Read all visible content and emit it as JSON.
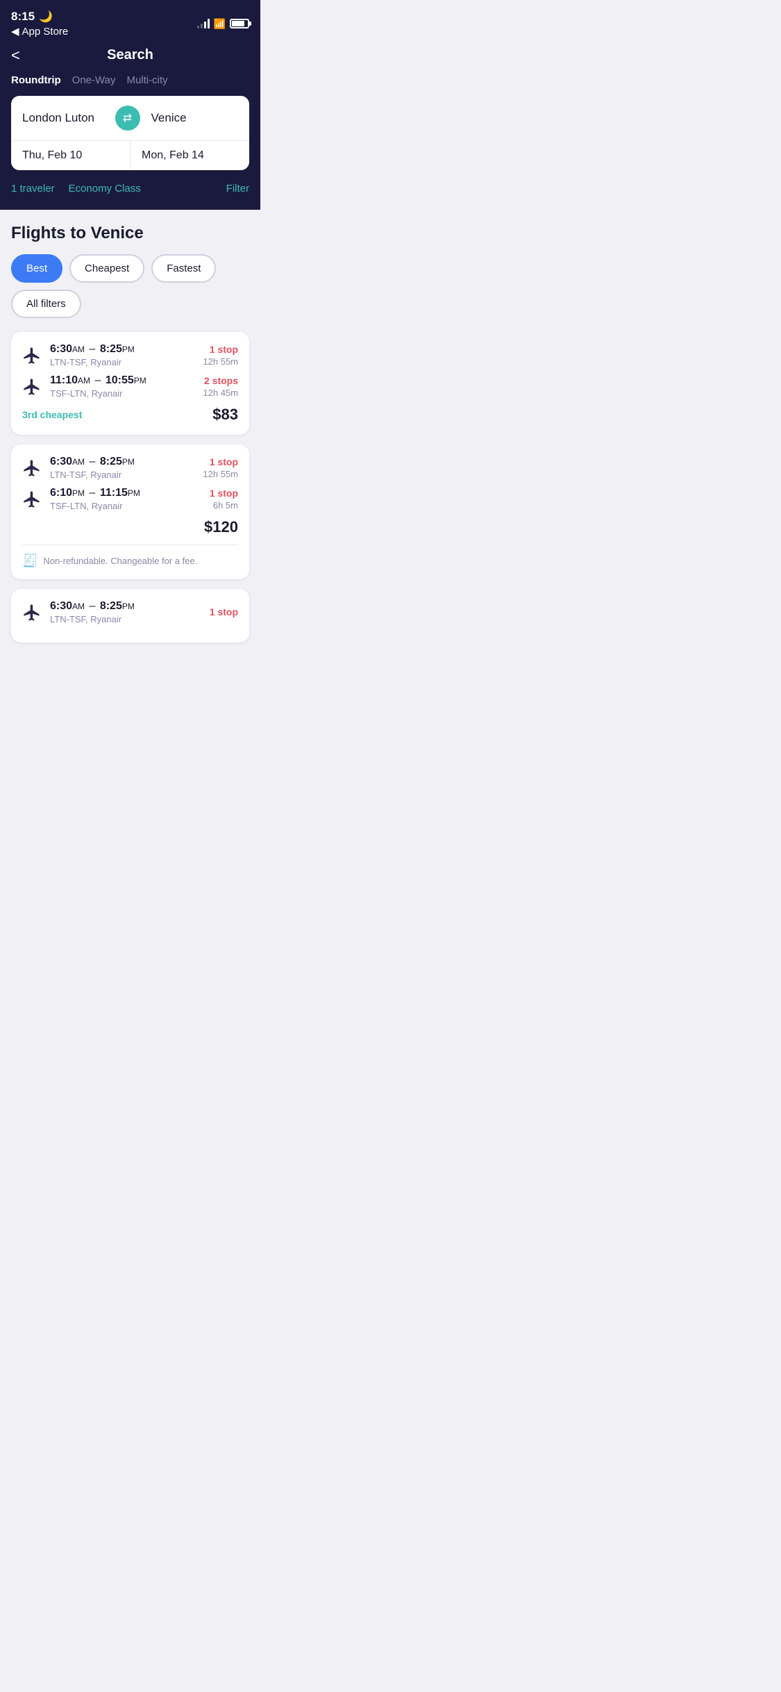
{
  "statusBar": {
    "time": "8:15",
    "moonIcon": "🌙",
    "storeLabel": "App Store",
    "backChevron": "◀"
  },
  "header": {
    "backLabel": "<",
    "title": "Search",
    "tripTabs": [
      {
        "label": "Roundtrip",
        "active": true
      },
      {
        "label": "One-Way",
        "active": false
      },
      {
        "label": "Multi-city",
        "active": false
      }
    ],
    "fromAirport": "London Luton",
    "toAirport": "Venice",
    "departDate": "Thu, Feb 10",
    "returnDate": "Mon, Feb 14",
    "travelers": "1 traveler",
    "cabinClass": "Economy Class",
    "filterLabel": "Filter"
  },
  "results": {
    "sectionTitle": "Flights to Venice",
    "sortTabs": [
      {
        "label": "Best",
        "active": true
      },
      {
        "label": "Cheapest",
        "active": false
      },
      {
        "label": "Fastest",
        "active": false
      },
      {
        "label": "All filters",
        "active": false
      }
    ],
    "cards": [
      {
        "legs": [
          {
            "departTime": "6:30",
            "departAmPm": "AM",
            "arriveTime": "8:25",
            "arriveAmPm": "PM",
            "route": "LTN-TSF, Ryanair",
            "stops": "1 stop",
            "duration": "12h 55m"
          },
          {
            "departTime": "11:10",
            "departAmPm": "AM",
            "arriveTime": "10:55",
            "arriveAmPm": "PM",
            "route": "TSF-LTN, Ryanair",
            "stops": "2 stops",
            "duration": "12h 45m"
          }
        ],
        "badge": "3rd cheapest",
        "price": "$83",
        "hasRefundNote": false
      },
      {
        "legs": [
          {
            "departTime": "6:30",
            "departAmPm": "AM",
            "arriveTime": "8:25",
            "arriveAmPm": "PM",
            "route": "LTN-TSF, Ryanair",
            "stops": "1 stop",
            "duration": "12h 55m"
          },
          {
            "departTime": "6:10",
            "departAmPm": "PM",
            "arriveTime": "11:15",
            "arriveAmPm": "PM",
            "route": "TSF-LTN, Ryanair",
            "stops": "1 stop",
            "duration": "6h 5m"
          }
        ],
        "badge": "",
        "price": "$120",
        "hasRefundNote": true,
        "refundNote": "Non-refundable. Changeable for a fee."
      },
      {
        "legs": [
          {
            "departTime": "6:30",
            "departAmPm": "AM",
            "arriveTime": "8:25",
            "arriveAmPm": "PM",
            "route": "LTN-TSF, Ryanair",
            "stops": "1 stop",
            "duration": ""
          }
        ],
        "badge": "",
        "price": "",
        "hasRefundNote": false,
        "partial": true
      }
    ]
  }
}
